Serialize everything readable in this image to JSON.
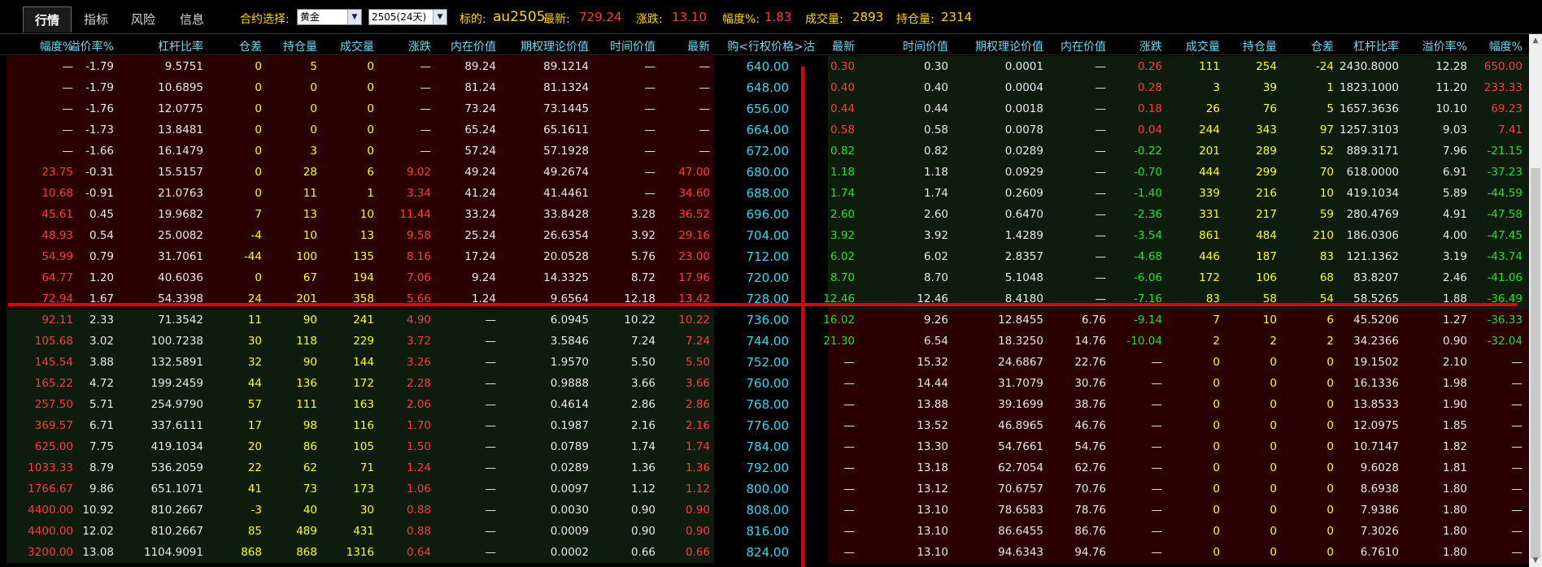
{
  "tabs": [
    {
      "label": "行情",
      "active": true
    },
    {
      "label": "指标",
      "active": false
    },
    {
      "label": "风险",
      "active": false
    },
    {
      "label": "信息",
      "active": false
    }
  ],
  "contract_select": {
    "label": "合约选择:",
    "value": "黄金"
  },
  "expiry_select": {
    "value": "2505(24天)"
  },
  "quote": {
    "underlying_label": "标的:",
    "underlying": "au2505",
    "last_label": "最新:",
    "last": "729.24",
    "change_label": "涨跌:",
    "change": "13.10",
    "pct_label": "幅度%:",
    "pct": "1.83",
    "volume_label": "成交量:",
    "volume": "2893",
    "oi_label": "持仓量:",
    "oi": "2314"
  },
  "columns": {
    "call": [
      "幅度%",
      "溢价率%",
      "杠杆比率",
      "仓差",
      "持仓量",
      "成交量",
      "涨跌",
      "内在价值",
      "期权理论价值",
      "时间价值",
      "最新"
    ],
    "strike": "购<行权价格>沽",
    "put": [
      "最新",
      "时间价值",
      "期权理论价值",
      "内在价值",
      "涨跌",
      "成交量",
      "持仓量",
      "仓差",
      "杠杆比率",
      "溢价率%",
      "幅度%"
    ]
  },
  "colors": {
    "red": "#ff3a3a",
    "green": "#22e022",
    "yellow": "#ffff00",
    "white": "#e8e8e8",
    "cyan": "#33d6f0",
    "bg_red": "#2a0000",
    "bg_green": "#0e1c0e"
  },
  "rows": [
    {
      "call": [
        "—",
        "-1.79",
        "9.5751",
        "0",
        "5",
        "0",
        "—",
        "89.24",
        "89.1214",
        "—",
        "—"
      ],
      "strike": "640.00",
      "put": [
        "0.30",
        "0.30",
        "0.0001",
        "—",
        "0.26",
        "111",
        "254",
        "-24",
        "2430.8000",
        "12.28",
        "650.00"
      ]
    },
    {
      "call": [
        "—",
        "-1.79",
        "10.6895",
        "0",
        "0",
        "0",
        "—",
        "81.24",
        "81.1324",
        "—",
        "—"
      ],
      "strike": "648.00",
      "put": [
        "0.40",
        "0.40",
        "0.0004",
        "—",
        "0.28",
        "3",
        "39",
        "1",
        "1823.1000",
        "11.20",
        "233.33"
      ]
    },
    {
      "call": [
        "—",
        "-1.76",
        "12.0775",
        "0",
        "0",
        "0",
        "—",
        "73.24",
        "73.1445",
        "—",
        "—"
      ],
      "strike": "656.00",
      "put": [
        "0.44",
        "0.44",
        "0.0018",
        "—",
        "0.18",
        "26",
        "76",
        "5",
        "1657.3636",
        "10.10",
        "69.23"
      ]
    },
    {
      "call": [
        "—",
        "-1.73",
        "13.8481",
        "0",
        "0",
        "0",
        "—",
        "65.24",
        "65.1611",
        "—",
        "—"
      ],
      "strike": "664.00",
      "put": [
        "0.58",
        "0.58",
        "0.0078",
        "—",
        "0.04",
        "244",
        "343",
        "97",
        "1257.3103",
        "9.03",
        "7.41"
      ]
    },
    {
      "call": [
        "—",
        "-1.66",
        "16.1479",
        "0",
        "3",
        "0",
        "—",
        "57.24",
        "57.1928",
        "—",
        "—"
      ],
      "strike": "672.00",
      "put": [
        "0.82",
        "0.82",
        "0.0289",
        "—",
        "-0.22",
        "201",
        "289",
        "52",
        "889.3171",
        "7.96",
        "-21.15"
      ]
    },
    {
      "call": [
        "23.75",
        "-0.31",
        "15.5157",
        "0",
        "28",
        "6",
        "9.02",
        "49.24",
        "49.2674",
        "—",
        "47.00"
      ],
      "strike": "680.00",
      "put": [
        "1.18",
        "1.18",
        "0.0929",
        "—",
        "-0.70",
        "444",
        "299",
        "70",
        "618.0000",
        "6.91",
        "-37.23"
      ]
    },
    {
      "call": [
        "10.68",
        "-0.91",
        "21.0763",
        "0",
        "11",
        "1",
        "3.34",
        "41.24",
        "41.4461",
        "—",
        "34.60"
      ],
      "strike": "688.00",
      "put": [
        "1.74",
        "1.74",
        "0.2609",
        "—",
        "-1.40",
        "339",
        "216",
        "10",
        "419.1034",
        "5.89",
        "-44.59"
      ]
    },
    {
      "call": [
        "45.61",
        "0.45",
        "19.9682",
        "7",
        "13",
        "10",
        "11.44",
        "33.24",
        "33.8428",
        "3.28",
        "36.52"
      ],
      "strike": "696.00",
      "put": [
        "2.60",
        "2.60",
        "0.6470",
        "—",
        "-2.36",
        "331",
        "217",
        "59",
        "280.4769",
        "4.91",
        "-47.58"
      ]
    },
    {
      "call": [
        "48.93",
        "0.54",
        "25.0082",
        "-4",
        "10",
        "13",
        "9.58",
        "25.24",
        "26.6354",
        "3.92",
        "29.16"
      ],
      "strike": "704.00",
      "put": [
        "3.92",
        "3.92",
        "1.4289",
        "—",
        "-3.54",
        "861",
        "484",
        "210",
        "186.0306",
        "4.00",
        "-47.45"
      ]
    },
    {
      "call": [
        "54.99",
        "0.79",
        "31.7061",
        "-44",
        "100",
        "135",
        "8.16",
        "17.24",
        "20.0528",
        "5.76",
        "23.00"
      ],
      "strike": "712.00",
      "put": [
        "6.02",
        "6.02",
        "2.8357",
        "—",
        "-4.68",
        "446",
        "187",
        "83",
        "121.1362",
        "3.19",
        "-43.74"
      ]
    },
    {
      "call": [
        "64.77",
        "1.20",
        "40.6036",
        "0",
        "67",
        "194",
        "7.06",
        "9.24",
        "14.3325",
        "8.72",
        "17.96"
      ],
      "strike": "720.00",
      "put": [
        "8.70",
        "8.70",
        "5.1048",
        "—",
        "-6.06",
        "172",
        "106",
        "68",
        "83.8207",
        "2.46",
        "-41.06"
      ]
    },
    {
      "call": [
        "72.94",
        "1.67",
        "54.3398",
        "24",
        "201",
        "358",
        "5.66",
        "1.24",
        "9.6564",
        "12.18",
        "13.42"
      ],
      "strike": "728.00",
      "put": [
        "12.46",
        "12.46",
        "8.4180",
        "—",
        "-7.16",
        "83",
        "58",
        "54",
        "58.5265",
        "1.88",
        "-36.49"
      ]
    },
    {
      "call": [
        "92.11",
        "2.33",
        "71.3542",
        "11",
        "90",
        "241",
        "4.90",
        "—",
        "6.0945",
        "10.22",
        "10.22"
      ],
      "strike": "736.00",
      "put": [
        "16.02",
        "9.26",
        "12.8455",
        "6.76",
        "-9.14",
        "7",
        "10",
        "6",
        "45.5206",
        "1.27",
        "-36.33"
      ]
    },
    {
      "call": [
        "105.68",
        "3.02",
        "100.7238",
        "30",
        "118",
        "229",
        "3.72",
        "—",
        "3.5846",
        "7.24",
        "7.24"
      ],
      "strike": "744.00",
      "put": [
        "21.30",
        "6.54",
        "18.3250",
        "14.76",
        "-10.04",
        "2",
        "2",
        "2",
        "34.2366",
        "0.90",
        "-32.04"
      ]
    },
    {
      "call": [
        "145.54",
        "3.88",
        "132.5891",
        "32",
        "90",
        "144",
        "3.26",
        "—",
        "1.9570",
        "5.50",
        "5.50"
      ],
      "strike": "752.00",
      "put": [
        "—",
        "15.32",
        "24.6867",
        "22.76",
        "—",
        "0",
        "0",
        "0",
        "19.1502",
        "2.10",
        "—"
      ]
    },
    {
      "call": [
        "165.22",
        "4.72",
        "199.2459",
        "44",
        "136",
        "172",
        "2.28",
        "—",
        "0.9888",
        "3.66",
        "3.66"
      ],
      "strike": "760.00",
      "put": [
        "—",
        "14.44",
        "31.7079",
        "30.76",
        "—",
        "0",
        "0",
        "0",
        "16.1336",
        "1.98",
        "—"
      ]
    },
    {
      "call": [
        "257.50",
        "5.71",
        "254.9790",
        "57",
        "111",
        "163",
        "2.06",
        "—",
        "0.4614",
        "2.86",
        "2.86"
      ],
      "strike": "768.00",
      "put": [
        "—",
        "13.88",
        "39.1699",
        "38.76",
        "—",
        "0",
        "0",
        "0",
        "13.8533",
        "1.90",
        "—"
      ]
    },
    {
      "call": [
        "369.57",
        "6.71",
        "337.6111",
        "17",
        "98",
        "116",
        "1.70",
        "—",
        "0.1987",
        "2.16",
        "2.16"
      ],
      "strike": "776.00",
      "put": [
        "—",
        "13.52",
        "46.8965",
        "46.76",
        "—",
        "0",
        "0",
        "0",
        "12.0975",
        "1.85",
        "—"
      ]
    },
    {
      "call": [
        "625.00",
        "7.75",
        "419.1034",
        "20",
        "86",
        "105",
        "1.50",
        "—",
        "0.0789",
        "1.74",
        "1.74"
      ],
      "strike": "784.00",
      "put": [
        "—",
        "13.30",
        "54.7661",
        "54.76",
        "—",
        "0",
        "0",
        "0",
        "10.7147",
        "1.82",
        "—"
      ]
    },
    {
      "call": [
        "1033.33",
        "8.79",
        "536.2059",
        "22",
        "62",
        "71",
        "1.24",
        "—",
        "0.0289",
        "1.36",
        "1.36"
      ],
      "strike": "792.00",
      "put": [
        "—",
        "13.18",
        "62.7054",
        "62.76",
        "—",
        "0",
        "0",
        "0",
        "9.6028",
        "1.81",
        "—"
      ]
    },
    {
      "call": [
        "1766.67",
        "9.86",
        "651.1071",
        "41",
        "73",
        "173",
        "1.06",
        "—",
        "0.0097",
        "1.12",
        "1.12"
      ],
      "strike": "800.00",
      "put": [
        "—",
        "13.12",
        "70.6757",
        "70.76",
        "—",
        "0",
        "0",
        "0",
        "8.6938",
        "1.80",
        "—"
      ]
    },
    {
      "call": [
        "4400.00",
        "10.92",
        "810.2667",
        "-3",
        "40",
        "30",
        "0.88",
        "—",
        "0.0030",
        "0.90",
        "0.90"
      ],
      "strike": "808.00",
      "put": [
        "—",
        "13.10",
        "78.6583",
        "78.76",
        "—",
        "0",
        "0",
        "0",
        "7.9386",
        "1.80",
        "—"
      ]
    },
    {
      "call": [
        "4400.00",
        "12.02",
        "810.2667",
        "85",
        "489",
        "431",
        "0.88",
        "—",
        "0.0009",
        "0.90",
        "0.90"
      ],
      "strike": "816.00",
      "put": [
        "—",
        "13.10",
        "86.6455",
        "86.76",
        "—",
        "0",
        "0",
        "0",
        "7.3026",
        "1.80",
        "—"
      ]
    },
    {
      "call": [
        "3200.00",
        "13.08",
        "1104.9091",
        "868",
        "868",
        "1316",
        "0.64",
        "—",
        "0.0002",
        "0.66",
        "0.66"
      ],
      "strike": "824.00",
      "put": [
        "—",
        "13.10",
        "94.6343",
        "94.76",
        "—",
        "0",
        "0",
        "0",
        "6.7610",
        "1.80",
        "—"
      ]
    }
  ]
}
